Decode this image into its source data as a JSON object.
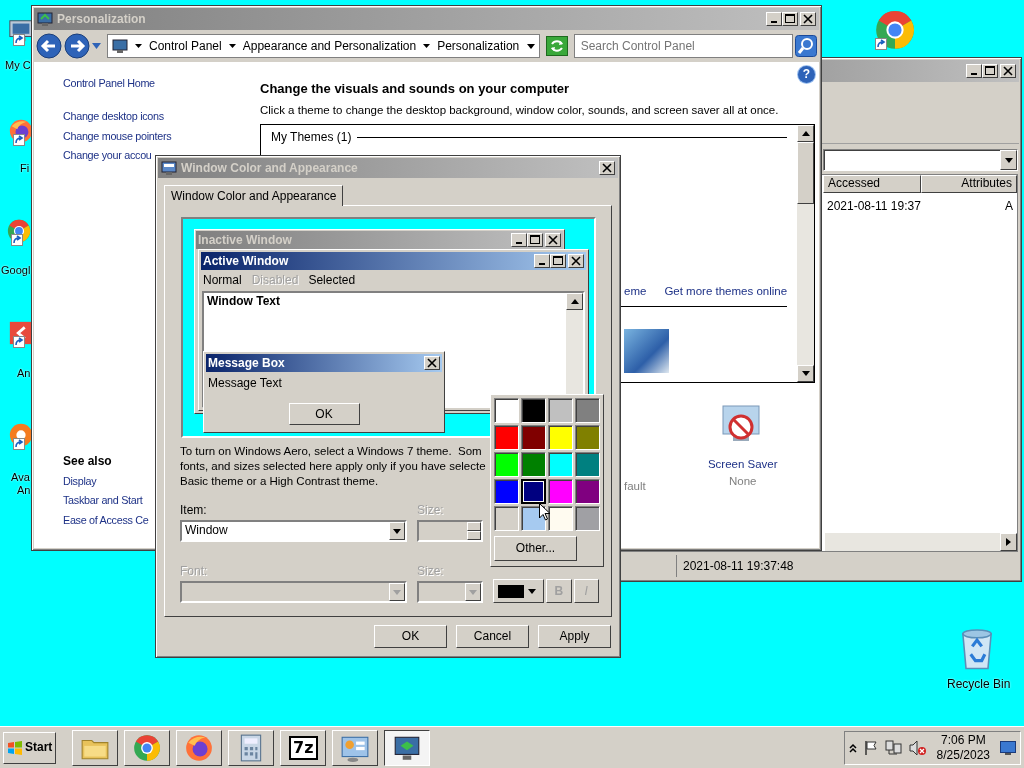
{
  "desktop": {
    "icons": [
      {
        "kind": "computer",
        "lines": [
          "My C"
        ]
      },
      {
        "kind": "firefox",
        "lines": [
          "Fi"
        ]
      },
      {
        "kind": "chrome",
        "lines": [
          "Googl"
        ]
      },
      {
        "kind": "red-app",
        "lines": [
          "An"
        ]
      },
      {
        "kind": "orange-app",
        "lines": [
          "Ava",
          "An"
        ]
      },
      {
        "kind": "chrome"
      },
      {
        "kind": "recycle-bin",
        "lines": [
          "Recycle Bin"
        ]
      }
    ]
  },
  "explorer_window": {
    "columns": [
      "Accessed",
      "Attributes"
    ],
    "rows": [
      [
        "2021-08-11 19:37",
        "A"
      ]
    ],
    "status": "2021-08-11 19:37:48"
  },
  "personalization": {
    "title": "Personalization",
    "breadcrumb": [
      "Control Panel",
      "Appearance and Personalization",
      "Personalization"
    ],
    "search_placeholder": "Search Control Panel",
    "help": "?",
    "sidebar": {
      "links": [
        "Control Panel Home",
        "Change desktop icons",
        "Change mouse pointers",
        "Change your accou"
      ],
      "see_also_heading": "See also",
      "see_also": [
        "Display",
        "Taskbar and Start",
        "Ease of Access Ce"
      ]
    },
    "heading": "Change the visuals and sounds on your computer",
    "description": "Click a theme to change the desktop background, window color, sounds, and screen saver all at once.",
    "theme_group": "My Themes (1)",
    "theme_links": [
      "eme",
      "Get more themes online"
    ],
    "covered_setting_value": "fault",
    "screen_saver": {
      "label": "Screen Saver",
      "value": "None"
    }
  },
  "dialog": {
    "title": "Window Color and Appearance",
    "tabs": [
      {
        "label": "Window Color and Appearance",
        "selected": true
      }
    ],
    "preview": {
      "inactive_title": "Inactive Window",
      "active_title": "Active Window",
      "menu": [
        {
          "label": "Normal",
          "kind": "normal"
        },
        {
          "label": "Disabled",
          "kind": "disabled"
        },
        {
          "label": "Selected",
          "kind": "selected"
        }
      ],
      "window_text": "Window Text",
      "message_title": "Message Box",
      "message_text": "Message Text",
      "message_button": "OK"
    },
    "description": [
      "To turn on Windows Aero, select a Windows 7 theme.  Som",
      "fonts, and sizes selected here apply only if you have selecte",
      "Basic theme or a High Contrast theme."
    ],
    "item": {
      "label": "Item:",
      "value": "Window"
    },
    "item_size": {
      "label": "Size:",
      "disabled": true
    },
    "font": {
      "label": "Font:",
      "disabled": true
    },
    "font_size": {
      "label": "Size:",
      "disabled": true
    },
    "font_color": {
      "color": "#000000"
    },
    "bold": {
      "label": "B",
      "disabled": true
    },
    "italic": {
      "label": "I",
      "disabled": true
    },
    "palette": {
      "colors": [
        {
          "color": "#ffffff",
          "selected": false
        },
        {
          "color": "#000000",
          "selected": false
        },
        {
          "color": "#c0c0c0",
          "selected": false
        },
        {
          "color": "#808080",
          "selected": false
        },
        {
          "color": "#ff0000",
          "selected": false
        },
        {
          "color": "#800000",
          "selected": false
        },
        {
          "color": "#ffff00",
          "selected": false
        },
        {
          "color": "#808000",
          "selected": false
        },
        {
          "color": "#00ff00",
          "selected": false
        },
        {
          "color": "#008000",
          "selected": false
        },
        {
          "color": "#00ffff",
          "selected": false
        },
        {
          "color": "#008080",
          "selected": false
        },
        {
          "color": "#0000ff",
          "selected": false
        },
        {
          "color": "#000080",
          "selected": true
        },
        {
          "color": "#ff00ff",
          "selected": false
        },
        {
          "color": "#800080",
          "selected": false
        },
        {
          "color": "#d4d0c8",
          "selected": false
        },
        {
          "color": "#a6caf0",
          "selected": false
        },
        {
          "color": "#fffbf0",
          "selected": false
        },
        {
          "color": "#a0a0a4",
          "selected": false
        }
      ],
      "other": "Other..."
    },
    "buttons": [
      "OK",
      "Cancel",
      "Apply"
    ]
  },
  "taskbar": {
    "start": "Start",
    "apps": [
      {
        "kind": "folder",
        "selected": false
      },
      {
        "kind": "chrome",
        "selected": false
      },
      {
        "kind": "firefox",
        "selected": false
      },
      {
        "kind": "calculator",
        "selected": false
      },
      {
        "kind": "archiver",
        "label": "7z",
        "selected": false
      },
      {
        "kind": "control-panel",
        "selected": false
      },
      {
        "kind": "display",
        "selected": true
      }
    ],
    "time": "7:06 PM",
    "date": "8/25/2023"
  }
}
